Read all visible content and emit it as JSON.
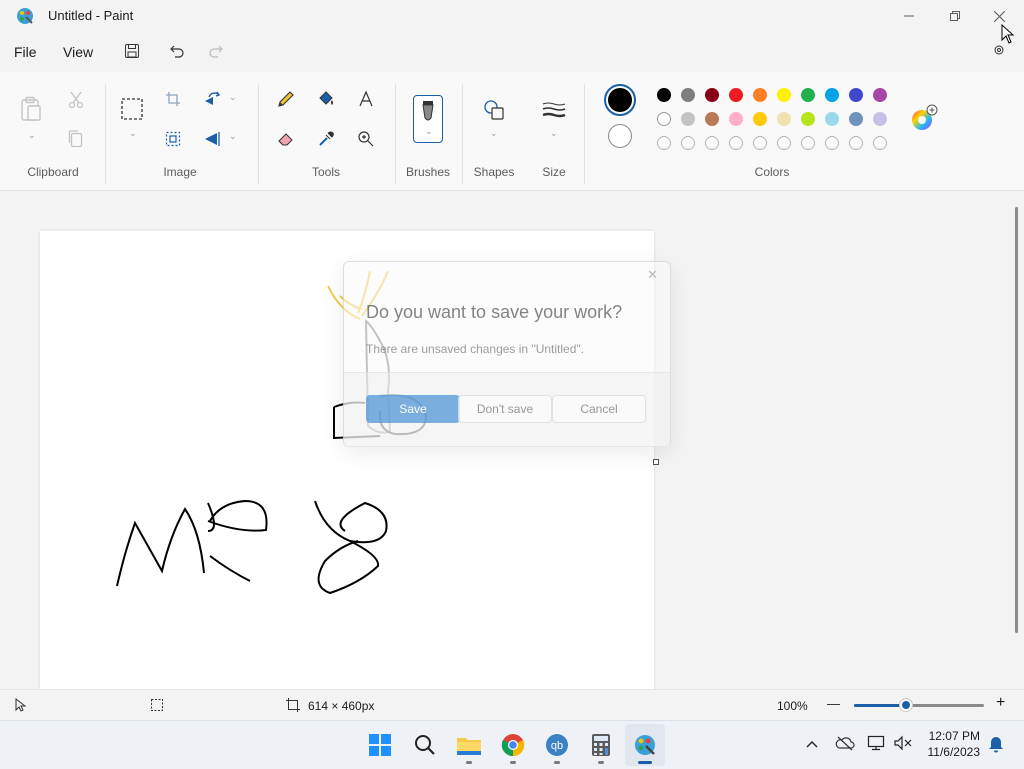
{
  "window": {
    "title": "Untitled - Paint"
  },
  "menu": {
    "file": "File",
    "view": "View"
  },
  "ribbon": {
    "groups": {
      "clipboard": "Clipboard",
      "image": "Image",
      "tools": "Tools",
      "brushes": "Brushes",
      "shapes": "Shapes",
      "size": "Size",
      "colors": "Colors"
    },
    "primary_color": "#000000",
    "secondary_color": "#ffffff",
    "palette_row1": [
      "#000000",
      "#7f7f7f",
      "#880015",
      "#ed1c24",
      "#ff7f27",
      "#fff200",
      "#22b14c",
      "#00a2e8",
      "#3f48cc",
      "#a349a4"
    ],
    "palette_row2": [
      "#ffffff",
      "#c3c3c3",
      "#b97a57",
      "#ffaec9",
      "#ffc90e",
      "#efe4b0",
      "#b5e61d",
      "#99d9ea",
      "#7092be",
      "#c8bfe7"
    ]
  },
  "dialog": {
    "title": "Do you want to save your work?",
    "message": "There are unsaved changes in \"Untitled\".",
    "save": "Save",
    "dont_save": "Don't save",
    "cancel": "Cancel",
    "close_glyph": "✕"
  },
  "statusbar": {
    "canvas_size": "614 × 460px",
    "zoom": "100%",
    "zoom_minus": "—",
    "zoom_plus": "+",
    "zoom_level_fraction": 0.4
  },
  "taskbar": {
    "time": "12:07 PM",
    "date": "11/6/2023"
  }
}
